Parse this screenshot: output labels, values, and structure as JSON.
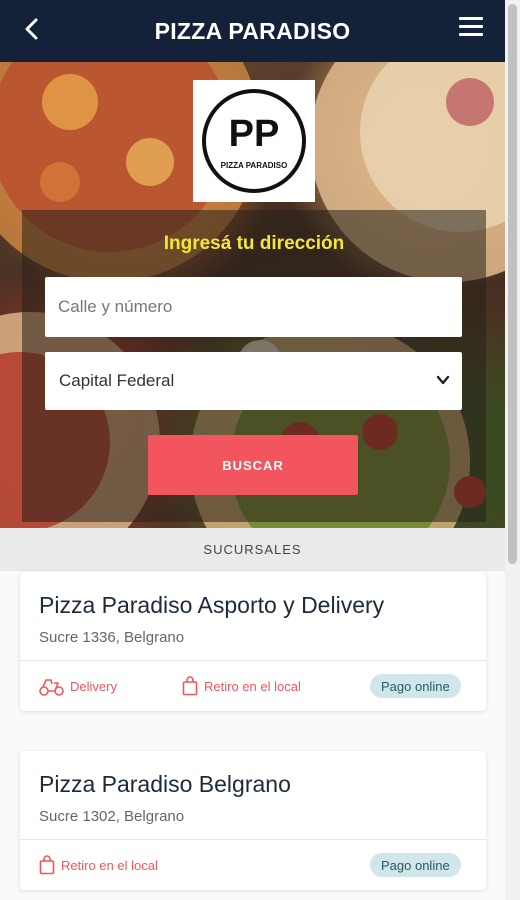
{
  "header": {
    "title": "PIZZA PARADISO",
    "back_icon": "arrow-left-icon",
    "menu_icon": "hamburger-menu-icon"
  },
  "logo": {
    "monogram": "PP",
    "wordmark": "PIZZA PARADISO"
  },
  "search": {
    "title": "Ingresá tu dirección",
    "street_placeholder": "Calle y número",
    "city_selected": "Capital Federal",
    "button_label": "BUSCAR"
  },
  "section": {
    "label": "SUCURSALES"
  },
  "branches": [
    {
      "name": "Pizza Paradiso Asporto y Delivery",
      "address": "Sucre 1336, Belgrano",
      "options": [
        "Delivery",
        "Retiro en el local"
      ],
      "badge": "Pago online"
    },
    {
      "name": "Pizza Paradiso Belgrano",
      "address": "Sucre 1302, Belgrano",
      "options": [
        "Retiro en el local"
      ],
      "badge": "Pago online"
    }
  ],
  "colors": {
    "header": "#132238",
    "accent": "#f2555e",
    "title_yellow": "#f4e53a",
    "badge_bg": "#cfe7ea"
  }
}
